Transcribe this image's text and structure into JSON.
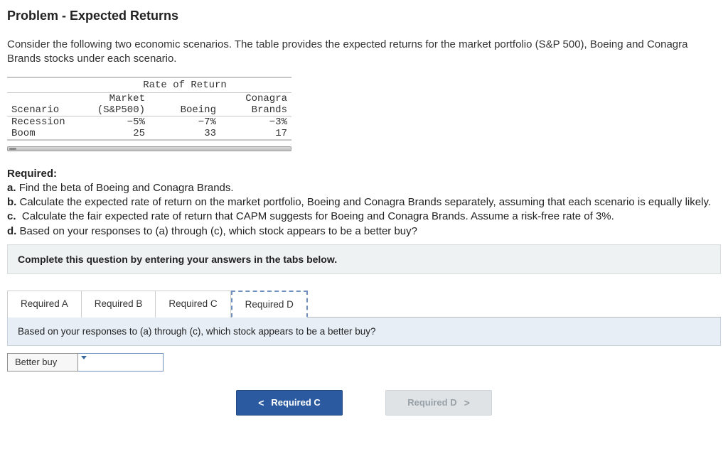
{
  "title": "Problem - Expected Returns",
  "intro": "Consider the following two economic scenarios. The table provides the expected returns for the market portfolio (S&P 500), Boeing and Conagra Brands stocks under each scenario.",
  "table": {
    "super_header": "Rate of Return",
    "headers": {
      "scenario": "Scenario",
      "market_l1": "Market",
      "market_l2": "(S&P500)",
      "boeing": "Boeing",
      "conagra_l1": "Conagra",
      "conagra_l2": "Brands"
    },
    "rows": [
      {
        "scenario": "Recession",
        "market": "−5%",
        "boeing": "−7%",
        "conagra": "−3%"
      },
      {
        "scenario": "Boom",
        "market": "25",
        "boeing": "33",
        "conagra": "17"
      }
    ]
  },
  "required": {
    "heading": "Required:",
    "a": "Find the beta of Boeing and Conagra Brands.",
    "b": "Calculate the expected rate of return on the market portfolio, Boeing and Conagra Brands separately, assuming that each scenario is equally likely.",
    "c": "Calculate the fair expected rate of return that CAPM suggests for Boeing and Conagra Brands. Assume a risk-free rate of 3%.",
    "d": "Based on your responses to (a) through (c), which stock appears to be a better buy?"
  },
  "instruction": "Complete this question by entering your answers in the tabs below.",
  "tabs": {
    "a": "Required A",
    "b": "Required B",
    "c": "Required C",
    "d": "Required D",
    "active": "d"
  },
  "panel_d": {
    "question": "Based on your responses to (a) through (c), which stock appears to be a better buy?",
    "answer_label": "Better buy"
  },
  "nav": {
    "prev_chev": "<",
    "prev": "Required C",
    "next": "Required D",
    "next_chev": ">"
  }
}
